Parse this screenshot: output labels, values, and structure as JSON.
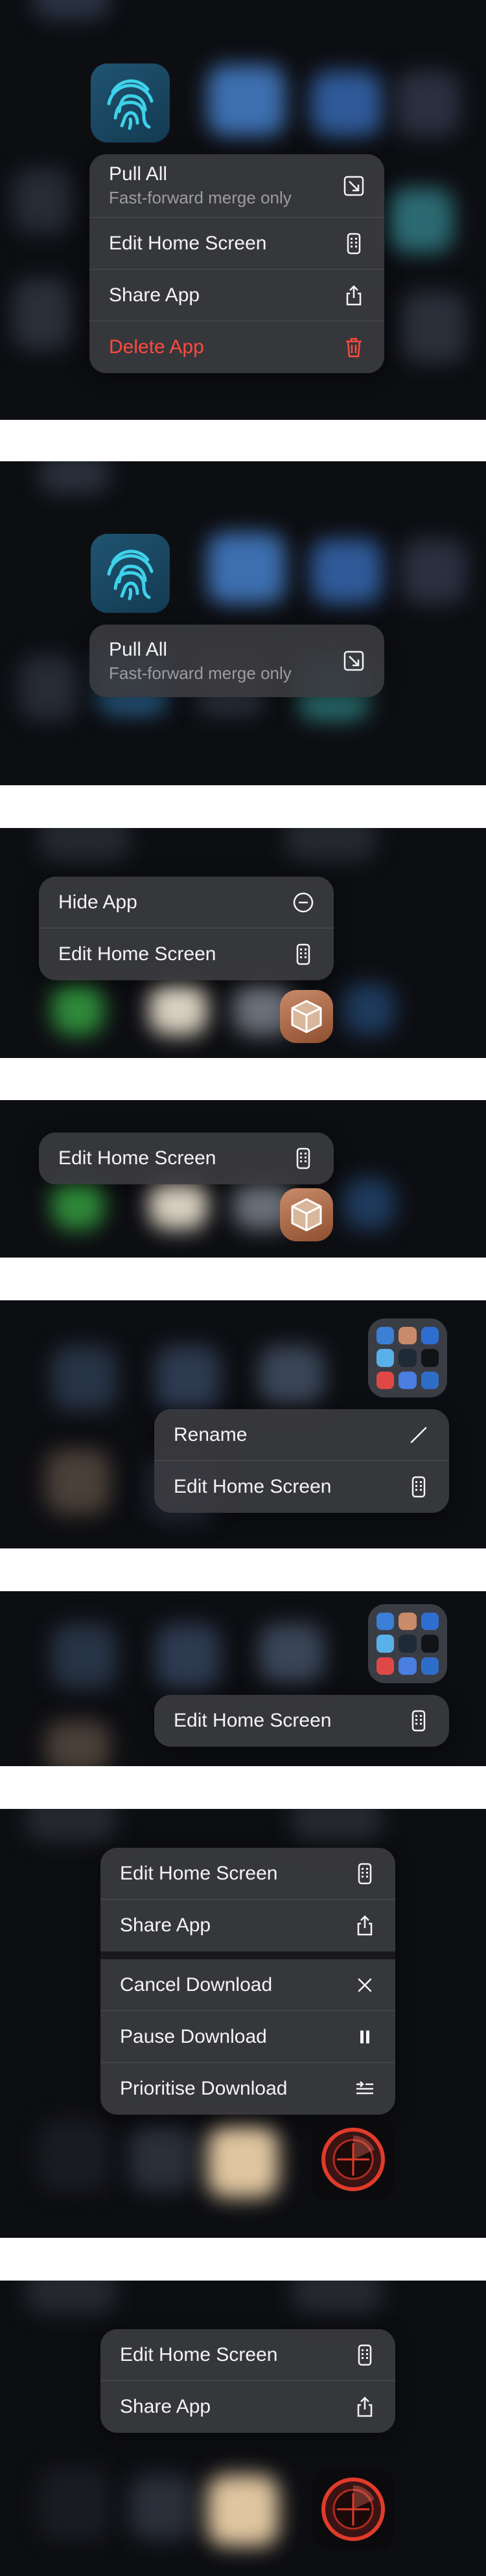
{
  "screens": [
    {
      "app": "fingerprint-app",
      "menu": [
        {
          "label": "Pull All",
          "sublabel": "Fast-forward merge only",
          "icon": "pull-arrow-icon"
        },
        {
          "label": "Edit Home Screen",
          "icon": "phone-apps-icon"
        },
        {
          "label": "Share App",
          "icon": "share-icon"
        },
        {
          "label": "Delete App",
          "icon": "trash-icon",
          "color": "#ff4a3f"
        }
      ]
    },
    {
      "app": "fingerprint-app",
      "menu": [
        {
          "label": "Pull All",
          "sublabel": "Fast-forward merge only",
          "icon": "pull-arrow-icon"
        }
      ]
    },
    {
      "app": "cydia-app",
      "menu": [
        {
          "label": "Hide App",
          "icon": "minus-circle-icon"
        },
        {
          "label": "Edit Home Screen",
          "icon": "phone-apps-icon"
        }
      ]
    },
    {
      "app": "cydia-app",
      "menu": [
        {
          "label": "Edit Home Screen",
          "icon": "phone-apps-icon"
        }
      ]
    },
    {
      "app": "app-folder",
      "menu": [
        {
          "label": "Rename",
          "icon": "pencil-icon"
        },
        {
          "label": "Edit Home Screen",
          "icon": "phone-apps-icon"
        }
      ]
    },
    {
      "app": "app-folder",
      "menu": [
        {
          "label": "Edit Home Screen",
          "icon": "phone-apps-icon"
        }
      ]
    },
    {
      "app": "downloading-app",
      "menu": [
        {
          "label": "Edit Home Screen",
          "icon": "phone-apps-icon"
        },
        {
          "label": "Share App",
          "icon": "share-icon"
        },
        {
          "label": "Cancel Download",
          "icon": "close-icon"
        },
        {
          "label": "Pause Download",
          "icon": "pause-icon"
        },
        {
          "label": "Prioritise Download",
          "icon": "prioritise-icon"
        }
      ]
    },
    {
      "app": "downloading-app",
      "menu": [
        {
          "label": "Edit Home Screen",
          "icon": "phone-apps-icon"
        },
        {
          "label": "Share App",
          "icon": "share-icon"
        }
      ]
    }
  ],
  "colors": {
    "menu_bg": "#3a3a3e",
    "text": "#f4f4f6",
    "subtext": "#9c9ca2",
    "danger": "#ff4a3f",
    "background": "#0d0e12"
  }
}
